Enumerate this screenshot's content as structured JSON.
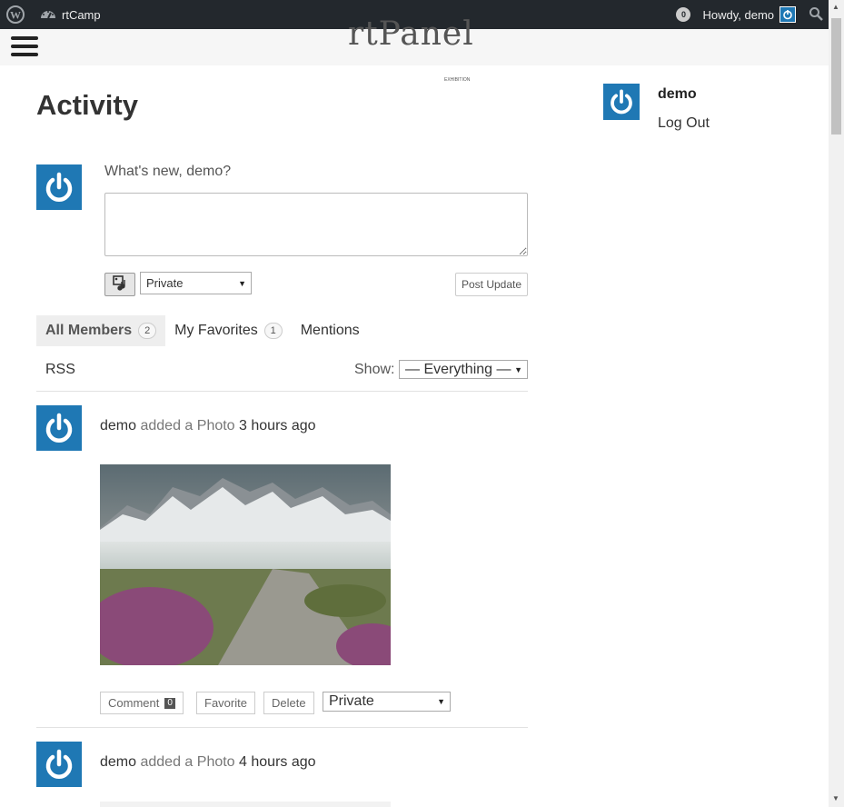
{
  "admin_bar": {
    "site_name": "rtCamp",
    "notification_count": "0",
    "howdy": "Howdy, demo"
  },
  "header": {
    "logo_text": "rtPanel",
    "logo_sub": "EXHIBITION"
  },
  "page": {
    "title": "Activity"
  },
  "post_form": {
    "prompt": "What's new, demo?",
    "textarea_value": "",
    "privacy": "Private",
    "submit_label": "Post Update"
  },
  "tabs": [
    {
      "label": "All Members",
      "count": "2"
    },
    {
      "label": "My Favorites",
      "count": "1"
    },
    {
      "label": "Mentions"
    }
  ],
  "filter": {
    "rss_label": "RSS",
    "show_label": "Show:",
    "selected": "— Everything —"
  },
  "activities": [
    {
      "user": "demo",
      "action": "added a Photo",
      "time": "3 hours ago",
      "buttons": {
        "comment": "Comment",
        "comment_count": "0",
        "favorite": "Favorite",
        "delete": "Delete"
      },
      "privacy": "Private"
    },
    {
      "user": "demo",
      "action": "added a Photo",
      "time": "4 hours ago"
    }
  ],
  "sidebar": {
    "username": "demo",
    "logout": "Log Out"
  },
  "colors": {
    "admin_bar_bg": "#23282d",
    "avatar_blue": "#1f78b4",
    "header_bg": "#f6f6f6",
    "active_tab_bg": "#eeeeee"
  }
}
